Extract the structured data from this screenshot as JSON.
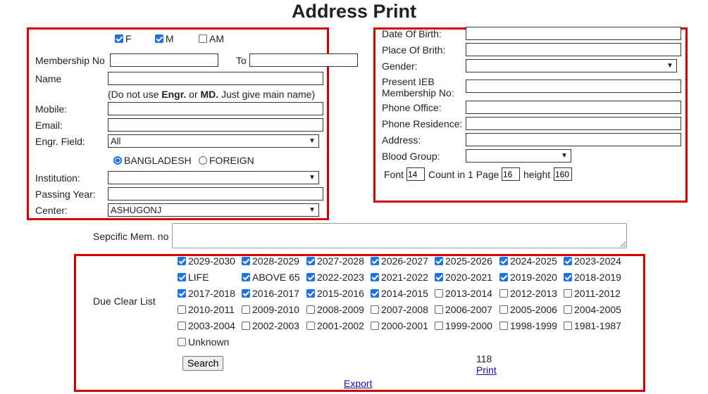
{
  "page": {
    "title": "Address Print"
  },
  "left": {
    "gender_checks": [
      {
        "label": "F",
        "checked": true
      },
      {
        "label": "M",
        "checked": true
      },
      {
        "label": "AM",
        "checked": false
      }
    ],
    "membership_no_label": "Membership No",
    "to_label": "To",
    "name_label": "Name",
    "name_hint_prefix": "(Do not use ",
    "name_hint_bold1": "Engr.",
    "name_hint_mid": " or ",
    "name_hint_bold2": "MD.",
    "name_hint_suffix": " Just give main name)",
    "mobile_label": "Mobile:",
    "email_label": "Email:",
    "engr_field_label": "Engr. Field:",
    "engr_field_value": "All",
    "country_options": [
      {
        "label": "BANGLADESH",
        "selected": true
      },
      {
        "label": "FOREIGN",
        "selected": false
      }
    ],
    "institution_label": "Institution:",
    "institution_value": "",
    "passing_year_label": "Passing Year:",
    "center_label": "Center:",
    "center_value": "ASHUGONJ"
  },
  "right": {
    "dob_label": "Date Of Birth:",
    "pob_label": "Place Of Brith:",
    "gender_label": "Gender:",
    "gender_value": "",
    "ieb_label_line1": "Present IEB",
    "ieb_label_line2": "Membership No:",
    "phone_office_label": "Phone Office:",
    "phone_residence_label": "Phone Residence:",
    "address_label": "Address:",
    "blood_group_label": "Blood Group:",
    "blood_group_value": "",
    "font_label": "Font",
    "font_value": "14",
    "count_label": "Count in 1 Page",
    "count_value": "16",
    "height_label": "height",
    "height_value": "160"
  },
  "specific": {
    "label": "Sepcific Mem. no"
  },
  "due": {
    "label": "Due Clear List",
    "items": [
      {
        "label": "2029-2030",
        "checked": true
      },
      {
        "label": "2028-2029",
        "checked": true
      },
      {
        "label": "2027-2028",
        "checked": true
      },
      {
        "label": "2026-2027",
        "checked": true
      },
      {
        "label": "2025-2026",
        "checked": true
      },
      {
        "label": "2024-2025",
        "checked": true
      },
      {
        "label": "2023-2024",
        "checked": true
      },
      {
        "label": "LIFE",
        "checked": true
      },
      {
        "label": "ABOVE 65",
        "checked": true
      },
      {
        "label": "2022-2023",
        "checked": true
      },
      {
        "label": "2021-2022",
        "checked": true
      },
      {
        "label": "2020-2021",
        "checked": true
      },
      {
        "label": "2019-2020",
        "checked": true
      },
      {
        "label": "2018-2019",
        "checked": true
      },
      {
        "label": "2017-2018",
        "checked": true
      },
      {
        "label": "2016-2017",
        "checked": true
      },
      {
        "label": "2015-2016",
        "checked": true
      },
      {
        "label": "2014-2015",
        "checked": true
      },
      {
        "label": "2013-2014",
        "checked": false
      },
      {
        "label": "2012-2013",
        "checked": false
      },
      {
        "label": "2011-2012",
        "checked": false
      },
      {
        "label": "2010-2011",
        "checked": false
      },
      {
        "label": "2009-2010",
        "checked": false
      },
      {
        "label": "2008-2009",
        "checked": false
      },
      {
        "label": "2007-2008",
        "checked": false
      },
      {
        "label": "2006-2007",
        "checked": false
      },
      {
        "label": "2005-2006",
        "checked": false
      },
      {
        "label": "2004-2005",
        "checked": false
      },
      {
        "label": "2003-2004",
        "checked": false
      },
      {
        "label": "2002-2003",
        "checked": false
      },
      {
        "label": "2001-2002",
        "checked": false
      },
      {
        "label": "2000-2001",
        "checked": false
      },
      {
        "label": "1999-2000",
        "checked": false
      },
      {
        "label": "1998-1999",
        "checked": false
      },
      {
        "label": "1981-1987",
        "checked": false
      },
      {
        "label": "Unknown",
        "checked": false
      }
    ],
    "search_label": "Search",
    "count": "118",
    "print_label": "Print",
    "export_label": "Export"
  },
  "colors": {
    "accent": "#1a73e8",
    "frame": "#d40000",
    "link": "#1a0dab"
  }
}
